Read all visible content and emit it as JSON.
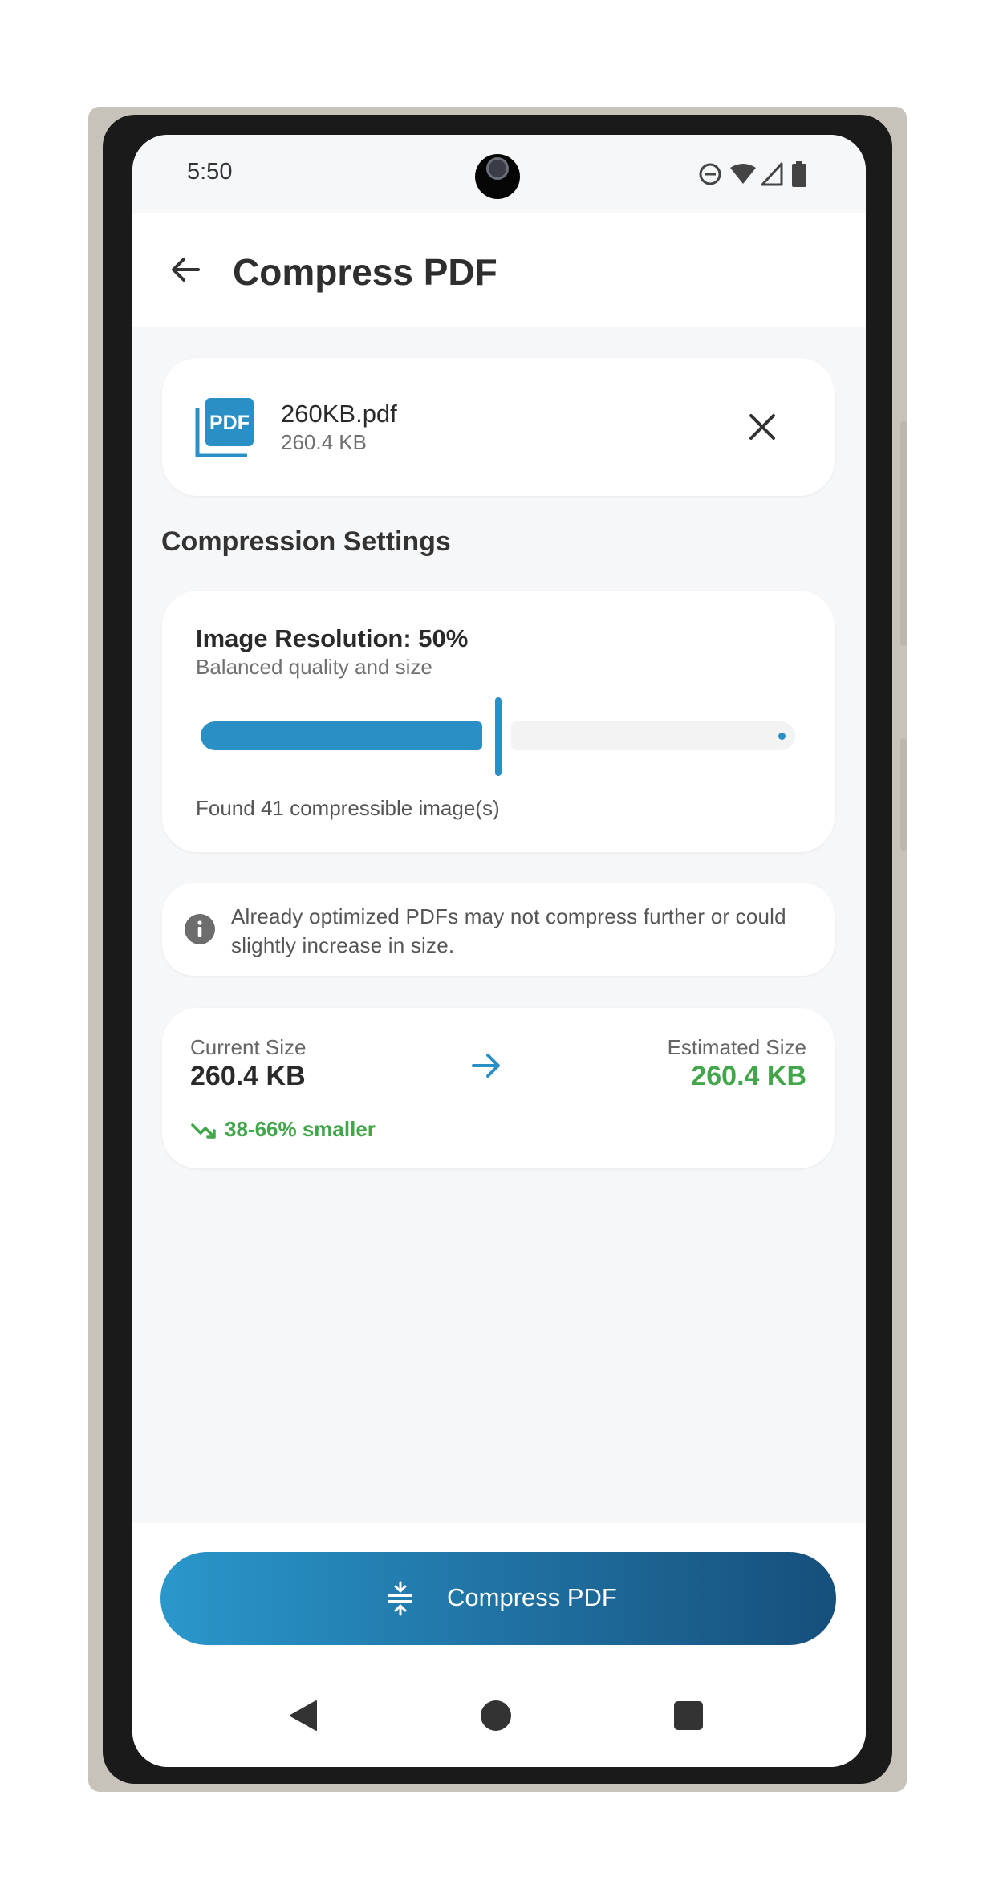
{
  "status_bar": {
    "time": "5:50",
    "icons": [
      "do-not-disturb-icon",
      "wifi-icon",
      "signal-icon",
      "battery-icon"
    ]
  },
  "app_bar": {
    "title": "Compress PDF",
    "back_icon": "arrow-back-icon"
  },
  "file": {
    "icon": "pdf-file-icon",
    "icon_text": "PDF",
    "name": "260KB.pdf",
    "size": "260.4 KB",
    "remove_icon": "close-icon"
  },
  "settings": {
    "heading": "Compression Settings",
    "resolution_title": "Image Resolution: 50%",
    "resolution_subtitle": "Balanced quality and size",
    "slider_value_percent": 50,
    "found_text": "Found 41 compressible image(s)"
  },
  "info": {
    "icon": "info-icon",
    "text": "Already optimized PDFs may not compress further or could slightly increase in size."
  },
  "sizes": {
    "current_label": "Current Size",
    "current_value": "260.4 KB",
    "estimated_label": "Estimated Size",
    "estimated_value": "260.4 KB",
    "reduction_text": "38-66% smaller",
    "arrow_icon": "arrow-forward-icon",
    "trend_icon": "trending-down-icon"
  },
  "action": {
    "label": "Compress PDF",
    "icon": "compress-icon"
  },
  "nav": {
    "back": "nav-back-icon",
    "home": "nav-home-icon",
    "recents": "nav-recents-icon"
  },
  "colors": {
    "primary": "#2a8fc4",
    "success": "#42a64a",
    "button_gradient_end": "#164f7c"
  }
}
